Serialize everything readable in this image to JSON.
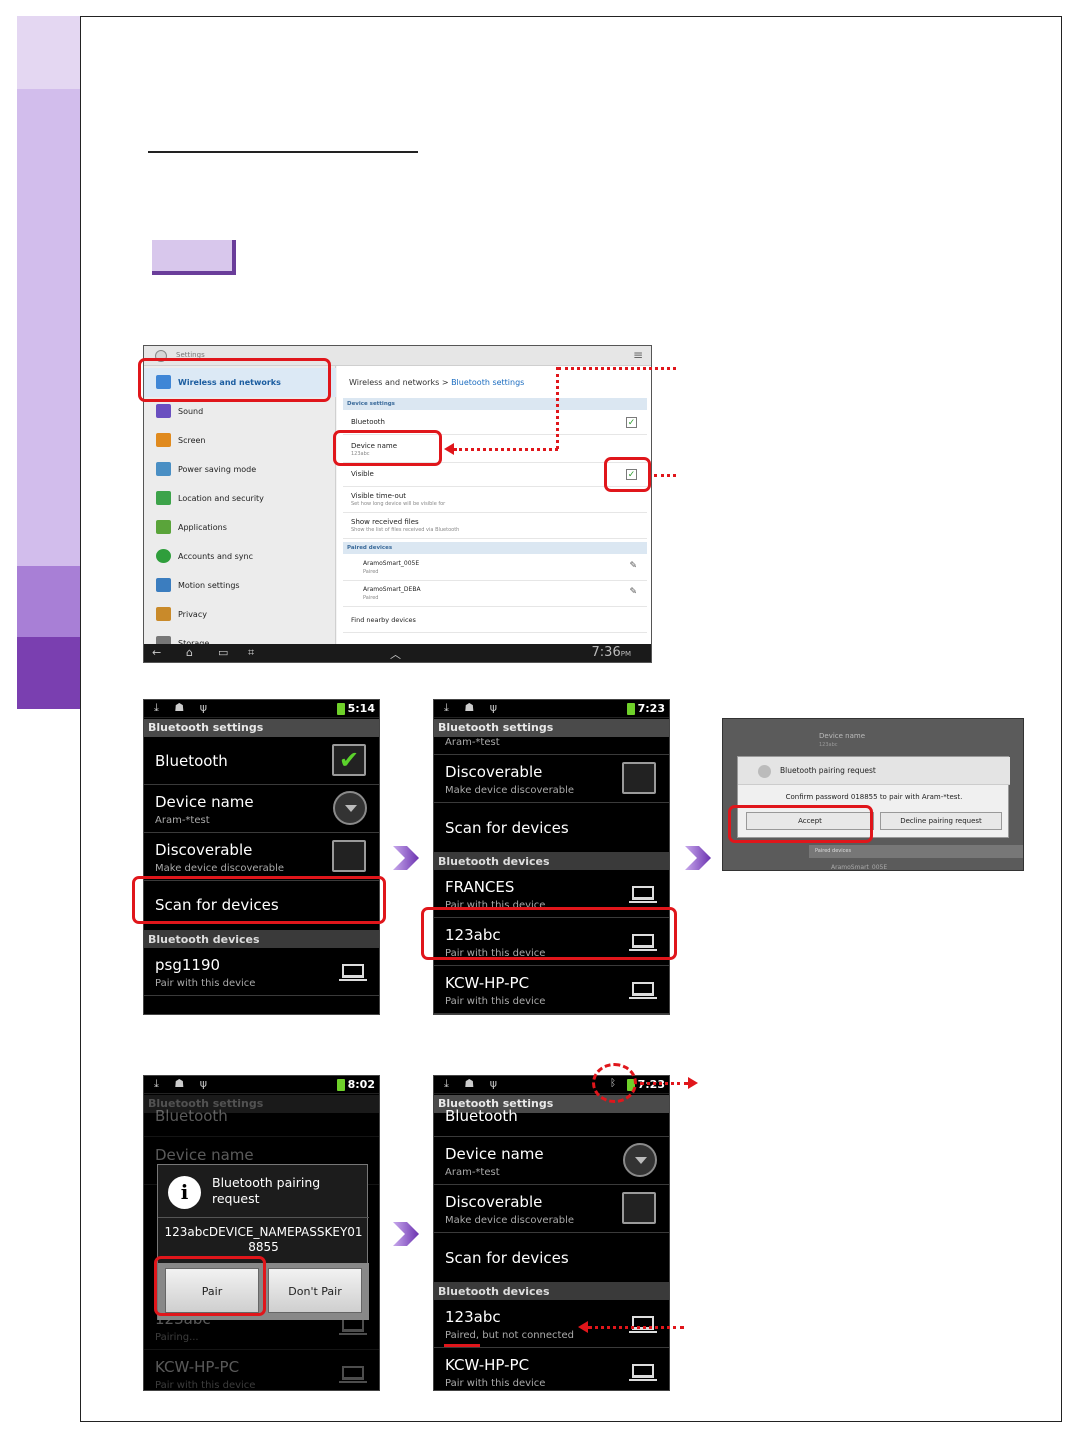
{
  "colors": {
    "accent_red": "#e0161b",
    "purple_light": "#e4d7f2",
    "purple_mid": "#c8aee6",
    "purple_dark": "#7a3fb0"
  },
  "tablet": {
    "top_label": "Settings",
    "menu": [
      {
        "label": "Wireless and networks",
        "icon": "wifi-icon"
      },
      {
        "label": "Sound",
        "icon": "speaker-icon"
      },
      {
        "label": "Screen",
        "icon": "screen-icon"
      },
      {
        "label": "Power saving mode",
        "icon": "power-icon"
      },
      {
        "label": "Location and security",
        "icon": "location-icon"
      },
      {
        "label": "Applications",
        "icon": "apps-icon"
      },
      {
        "label": "Accounts and sync",
        "icon": "sync-icon"
      },
      {
        "label": "Motion settings",
        "icon": "motion-icon"
      },
      {
        "label": "Privacy",
        "icon": "privacy-icon"
      },
      {
        "label": "Storage",
        "icon": "storage-icon"
      }
    ],
    "breadcrumb_parent": "Wireless and networks",
    "breadcrumb_sep": ">",
    "breadcrumb_current": "Bluetooth settings",
    "section_device": "Device settings",
    "bluetooth_label": "Bluetooth",
    "device_name_label": "Device name",
    "device_name_value": "123abc",
    "visible_label": "Visible",
    "visible_timeout_label": "Visible time-out",
    "visible_timeout_sub": "Set how long device will be visible for",
    "show_files_label": "Show received files",
    "show_files_sub": "Show the list of files received via Bluetooth",
    "section_paired": "Paired devices",
    "paired": [
      {
        "name": "AramoSmart_005E",
        "status": "Paired"
      },
      {
        "name": "AramoSmart_DEBA",
        "status": "Paired"
      }
    ],
    "find_label": "Find nearby devices",
    "clock": "7:36",
    "ampm": "PM"
  },
  "phone1": {
    "time": "5:14",
    "header": "Bluetooth settings",
    "bluetooth": "Bluetooth",
    "device_name": "Device name",
    "device_name_value": "Aram-*test",
    "discoverable": "Discoverable",
    "discoverable_sub": "Make device discoverable",
    "scan": "Scan for devices",
    "devices_header": "Bluetooth devices",
    "device1": "psg1190",
    "device1_sub": "Pair with this device"
  },
  "phone2": {
    "time": "7:23",
    "header": "Bluetooth settings",
    "top_partial": "Aram-*test",
    "discoverable": "Discoverable",
    "discoverable_sub": "Make device discoverable",
    "scan": "Scan for devices",
    "devices_header": "Bluetooth devices",
    "devices": [
      {
        "name": "FRANCES",
        "sub": "Pair with this device"
      },
      {
        "name": "123abc",
        "sub": "Pair with this device"
      },
      {
        "name": "KCW-HP-PC",
        "sub": "Pair with this device"
      }
    ]
  },
  "popup": {
    "bg_label": "Device name",
    "bg_sub": "123abc",
    "title": "Bluetooth pairing request",
    "message": "Confirm password 018855 to pair with Aram-*test.",
    "accept": "Accept",
    "decline": "Decline pairing request",
    "bg_section": "Paired devices",
    "bg_row": "AramoSmart_005E"
  },
  "phone3": {
    "time": "8:02",
    "header": "Bluetooth settings",
    "bg_top": "Bluetooth",
    "bg_device_name": "Device name",
    "bg_device": "123abc",
    "bg_device_sub": "Pairing...",
    "bg_device2": "KCW-HP-PC",
    "bg_device2_sub": "Pair with this device",
    "dialog_title": "Bluetooth pairing request",
    "dialog_message": "123abcDEVICE_NAMEPASSKEY018855",
    "pair": "Pair",
    "dont_pair": "Don't Pair"
  },
  "phone4": {
    "time": "7:23",
    "header": "Bluetooth settings",
    "top_partial": "Bluetooth",
    "device_name": "Device name",
    "device_name_value": "Aram-*test",
    "discoverable": "Discoverable",
    "discoverable_sub": "Make device discoverable",
    "scan": "Scan for devices",
    "devices_header": "Bluetooth devices",
    "device1": "123abc",
    "device1_sub": "Paired, but not connected",
    "device2": "KCW-HP-PC",
    "device2_sub": "Pair with this device"
  }
}
